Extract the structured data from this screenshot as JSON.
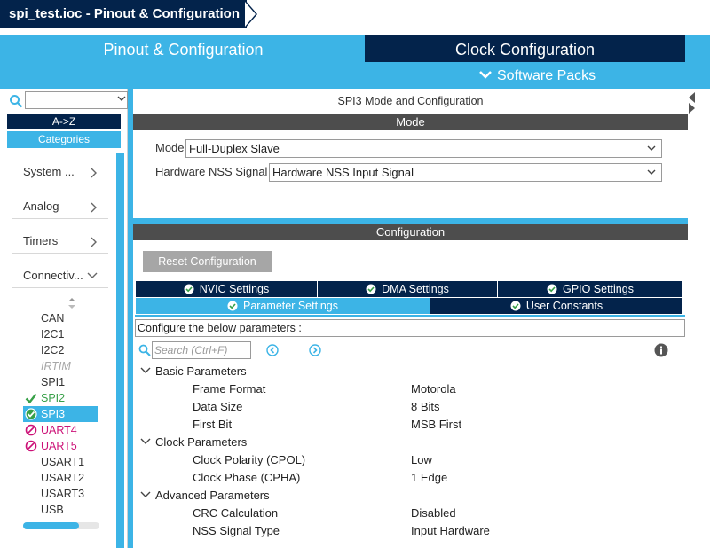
{
  "window": {
    "title": "spi_test.ioc - Pinout & Configuration"
  },
  "top_tabs": {
    "pinout": "Pinout & Configuration",
    "clock": "Clock Configuration",
    "software_packs": "Software Packs"
  },
  "sidebar": {
    "search_value": "",
    "az_label": "A->Z",
    "categories_label": "Categories",
    "categories": [
      {
        "label": "System ...",
        "icon": "chevron-right-icon"
      },
      {
        "label": "Analog",
        "icon": "chevron-right-icon"
      },
      {
        "label": "Timers",
        "icon": "chevron-right-icon"
      },
      {
        "label": "Connectiv...",
        "icon": "chevron-down-icon"
      }
    ],
    "peripherals": [
      {
        "label": "CAN",
        "status": "none"
      },
      {
        "label": "I2C1",
        "status": "none"
      },
      {
        "label": "I2C2",
        "status": "none"
      },
      {
        "label": "IRTIM",
        "status": "disabled"
      },
      {
        "label": "SPI1",
        "status": "none"
      },
      {
        "label": "SPI2",
        "status": "ok"
      },
      {
        "label": "SPI3",
        "status": "ok-selected"
      },
      {
        "label": "UART4",
        "status": "conflict"
      },
      {
        "label": "UART5",
        "status": "conflict"
      },
      {
        "label": "USART1",
        "status": "none"
      },
      {
        "label": "USART2",
        "status": "none"
      },
      {
        "label": "USART3",
        "status": "none"
      },
      {
        "label": "USB",
        "status": "none"
      }
    ]
  },
  "mode_panel": {
    "title": "SPI3 Mode and Configuration",
    "header": "Mode",
    "mode_label": "Mode",
    "mode_value": "Full-Duplex Slave",
    "nss_label": "Hardware NSS Signal",
    "nss_value": "Hardware NSS Input Signal"
  },
  "config_panel": {
    "header": "Configuration",
    "reset_button": "Reset Configuration",
    "tabs_row1": [
      "NVIC Settings",
      "DMA Settings",
      "GPIO Settings"
    ],
    "tabs_row2": [
      "Parameter Settings",
      "User Constants"
    ],
    "active_tab": "Parameter Settings",
    "configure_text": "Configure the below parameters :",
    "search_placeholder": "Search (Ctrl+F)",
    "groups": [
      {
        "name": "Basic Parameters",
        "params": [
          {
            "name": "Frame Format",
            "value": "Motorola"
          },
          {
            "name": "Data Size",
            "value": "8 Bits"
          },
          {
            "name": "First Bit",
            "value": "MSB First"
          }
        ]
      },
      {
        "name": "Clock Parameters",
        "params": [
          {
            "name": "Clock Polarity (CPOL)",
            "value": "Low"
          },
          {
            "name": "Clock Phase (CPHA)",
            "value": "1 Edge"
          }
        ]
      },
      {
        "name": "Advanced Parameters",
        "params": [
          {
            "name": "CRC Calculation",
            "value": "Disabled"
          },
          {
            "name": "NSS Signal Type",
            "value": "Input Hardware"
          }
        ]
      }
    ]
  },
  "colors": {
    "navy": "#03234b",
    "accent_blue": "#3cb4e6",
    "ok_green": "#37a048",
    "conflict_magenta": "#cc1177",
    "header_gray": "#4d4d4d"
  }
}
